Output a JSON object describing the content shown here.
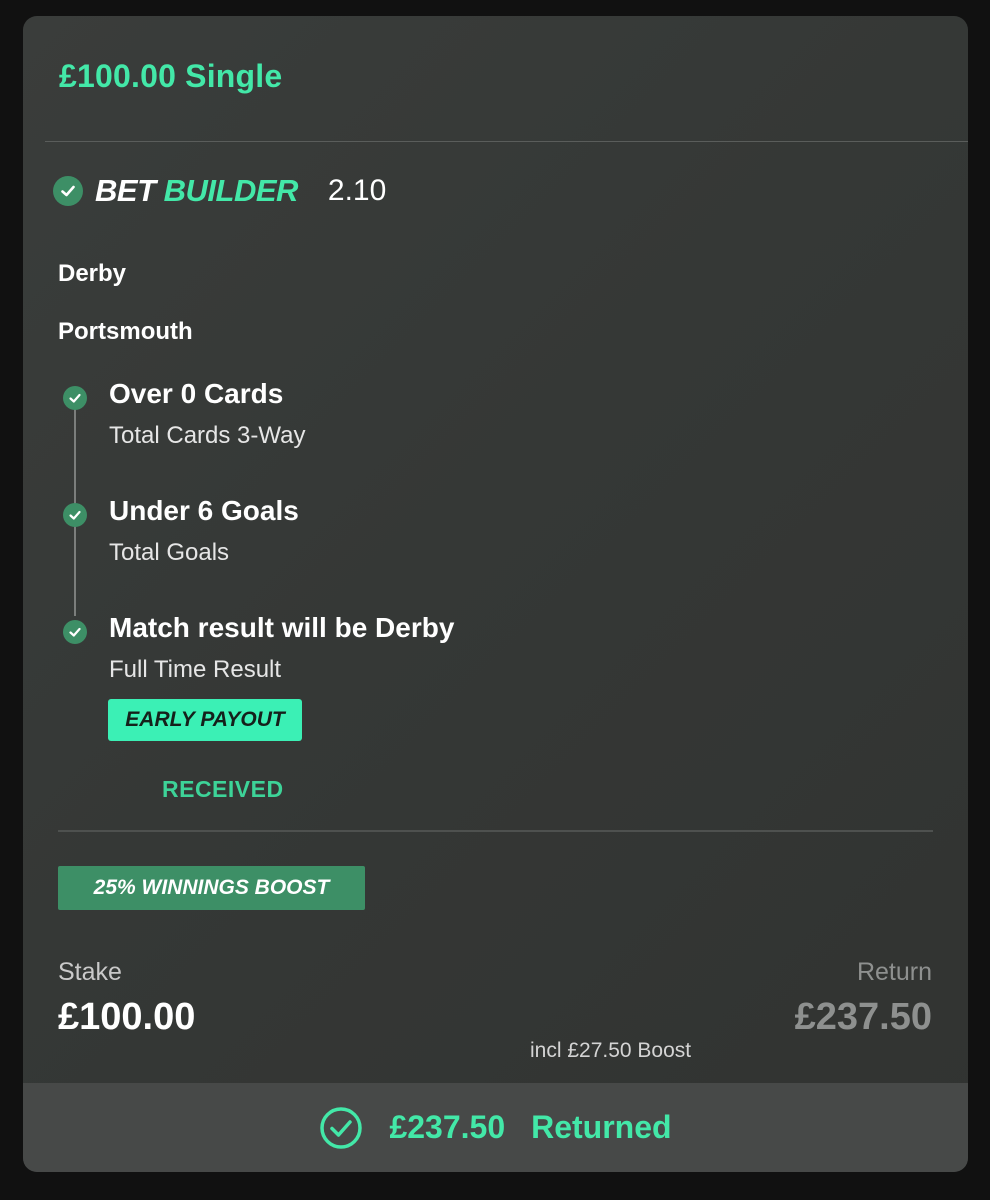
{
  "bet": {
    "title": "£100.00 Single",
    "builder": {
      "prefix": "BET",
      "suffix": "BUILDER",
      "odds": "2.10"
    },
    "teams": [
      "Derby",
      "Portsmouth"
    ],
    "selections": [
      {
        "name": "Over 0 Cards",
        "market": "Total Cards 3-Way"
      },
      {
        "name": "Under 6 Goals",
        "market": "Total Goals"
      },
      {
        "name": "Match result will be Derby",
        "market": "Full Time Result"
      }
    ],
    "early_payout": {
      "badge": "EARLY PAYOUT",
      "status": "RECEIVED"
    },
    "boost_badge": "25% WINNINGS BOOST",
    "stake": {
      "label": "Stake",
      "value": "£100.00"
    },
    "return": {
      "label": "Return",
      "value": "£237.50",
      "note": "incl £27.50 Boost"
    },
    "footer": {
      "amount": "£237.50",
      "status": "Returned"
    }
  },
  "colors": {
    "accent": "#43e8a8",
    "check": "#3d8f66",
    "card_bg": "#353836",
    "footer_bg": "#474948"
  },
  "icons": {
    "settled": "check-circle-icon",
    "returned": "check-circle-outline-icon"
  }
}
